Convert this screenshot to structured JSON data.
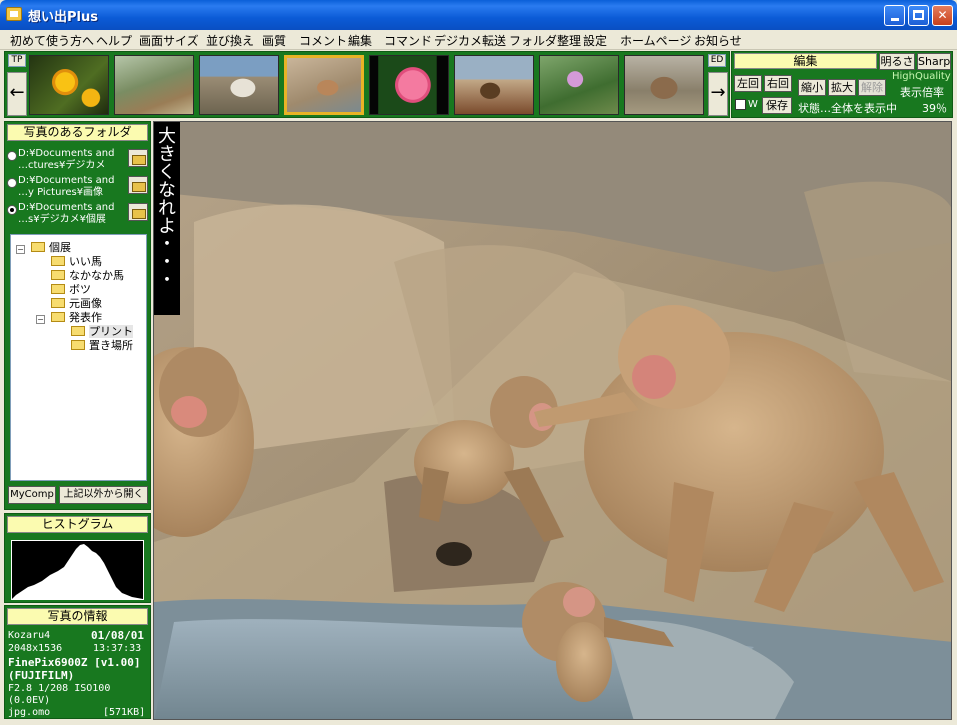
{
  "window": {
    "title": "想い出Plus"
  },
  "menu": [
    "初めて使う方へ",
    "ヘルプ",
    "画面サイズ",
    "並び換え",
    "画質",
    "コメント",
    "編集",
    "コマンド",
    "デジカメ転送",
    "フォルダ整理",
    "設定",
    "ホームページ",
    "お知らせ"
  ],
  "strip": {
    "tp": "TP",
    "ed": "ED",
    "left_arrow": "←",
    "right_arrow": "→"
  },
  "edit": {
    "title": "編集",
    "brightness": "明るさ",
    "sharp": "Sharp",
    "rotate_left": "左回",
    "rotate_right": "右回",
    "shrink": "縮小",
    "enlarge": "拡大",
    "release": "解除",
    "w": "W",
    "save": "保存",
    "quality": "HighQuality",
    "zoom_label": "表示倍率",
    "status": "状態…全体を表示中",
    "zoom_value": "39％"
  },
  "folders": {
    "title": "写真のあるフォルダ",
    "entries": [
      {
        "line1": "D:¥Documents and",
        "line2": "…ctures¥デジカメ"
      },
      {
        "line1": "D:¥Documents and",
        "line2": "…y Pictures¥画像"
      },
      {
        "line1": "D:¥Documents and",
        "line2": "…s¥デジカメ¥個展"
      }
    ],
    "tree": [
      "個展",
      "いい馬",
      "なかなか馬",
      "ボツ",
      "元画像",
      "発表作",
      "プリント",
      "置き場所"
    ],
    "mycomp": "MyComp",
    "open_other": "上記以外から開く"
  },
  "histogram": {
    "title": "ヒストグラム"
  },
  "info": {
    "title": "写真の情報",
    "name": "Kozaru4",
    "date": "01/08/01",
    "size": "2048x1536",
    "time": "13:37:33",
    "camera": "FinePix6900Z [v1.00]",
    "maker": "(FUJIFILM)",
    "exposure": "F2.8 1/208 ISO100",
    "ev": "(0.0EV)",
    "file": "jpg.omo",
    "filesize": "[571KB]"
  },
  "photo": {
    "caption": "大きくなれよ・・・"
  }
}
